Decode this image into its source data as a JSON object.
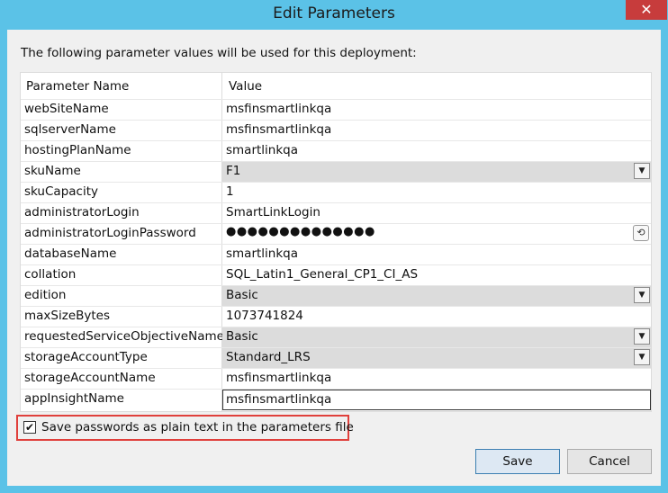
{
  "window": {
    "title": "Edit Parameters",
    "close_glyph": "✕"
  },
  "intro": "The following parameter values will be used for this deployment:",
  "grid": {
    "col_name": "Parameter Name",
    "col_value": "Value",
    "rows": [
      {
        "name": "webSiteName",
        "value": "msfinsmartlinkqa",
        "kind": "text"
      },
      {
        "name": "sqlserverName",
        "value": "msfinsmartlinkqa",
        "kind": "text"
      },
      {
        "name": "hostingPlanName",
        "value": "smartlinkqa",
        "kind": "text"
      },
      {
        "name": "skuName",
        "value": "F1",
        "kind": "combo"
      },
      {
        "name": "skuCapacity",
        "value": "1",
        "kind": "text"
      },
      {
        "name": "administratorLogin",
        "value": "SmartLinkLogin",
        "kind": "text"
      },
      {
        "name": "administratorLoginPassword",
        "value": "●●●●●●●●●●●●●●",
        "kind": "password"
      },
      {
        "name": "databaseName",
        "value": "smartlinkqa",
        "kind": "text"
      },
      {
        "name": "collation",
        "value": "SQL_Latin1_General_CP1_CI_AS",
        "kind": "text"
      },
      {
        "name": "edition",
        "value": "Basic",
        "kind": "combo"
      },
      {
        "name": "maxSizeBytes",
        "value": "1073741824",
        "kind": "text"
      },
      {
        "name": "requestedServiceObjectiveName",
        "value": "Basic",
        "kind": "combo"
      },
      {
        "name": "storageAccountType",
        "value": "Standard_LRS",
        "kind": "combo"
      },
      {
        "name": "storageAccountName",
        "value": "msfinsmartlinkqa",
        "kind": "text"
      },
      {
        "name": "appInsightName",
        "value": "msfinsmartlinkqa",
        "kind": "editing"
      }
    ]
  },
  "save_passwords": {
    "label": "Save passwords as plain text in the parameters file",
    "checked": true,
    "check_glyph": "✔"
  },
  "buttons": {
    "save": "Save",
    "cancel": "Cancel"
  },
  "icons": {
    "dropdown": "▼",
    "reveal": "⟲"
  },
  "colors": {
    "titlebar": "#5bc2e7",
    "close": "#c73c3c",
    "highlight_border": "#e0403c"
  }
}
